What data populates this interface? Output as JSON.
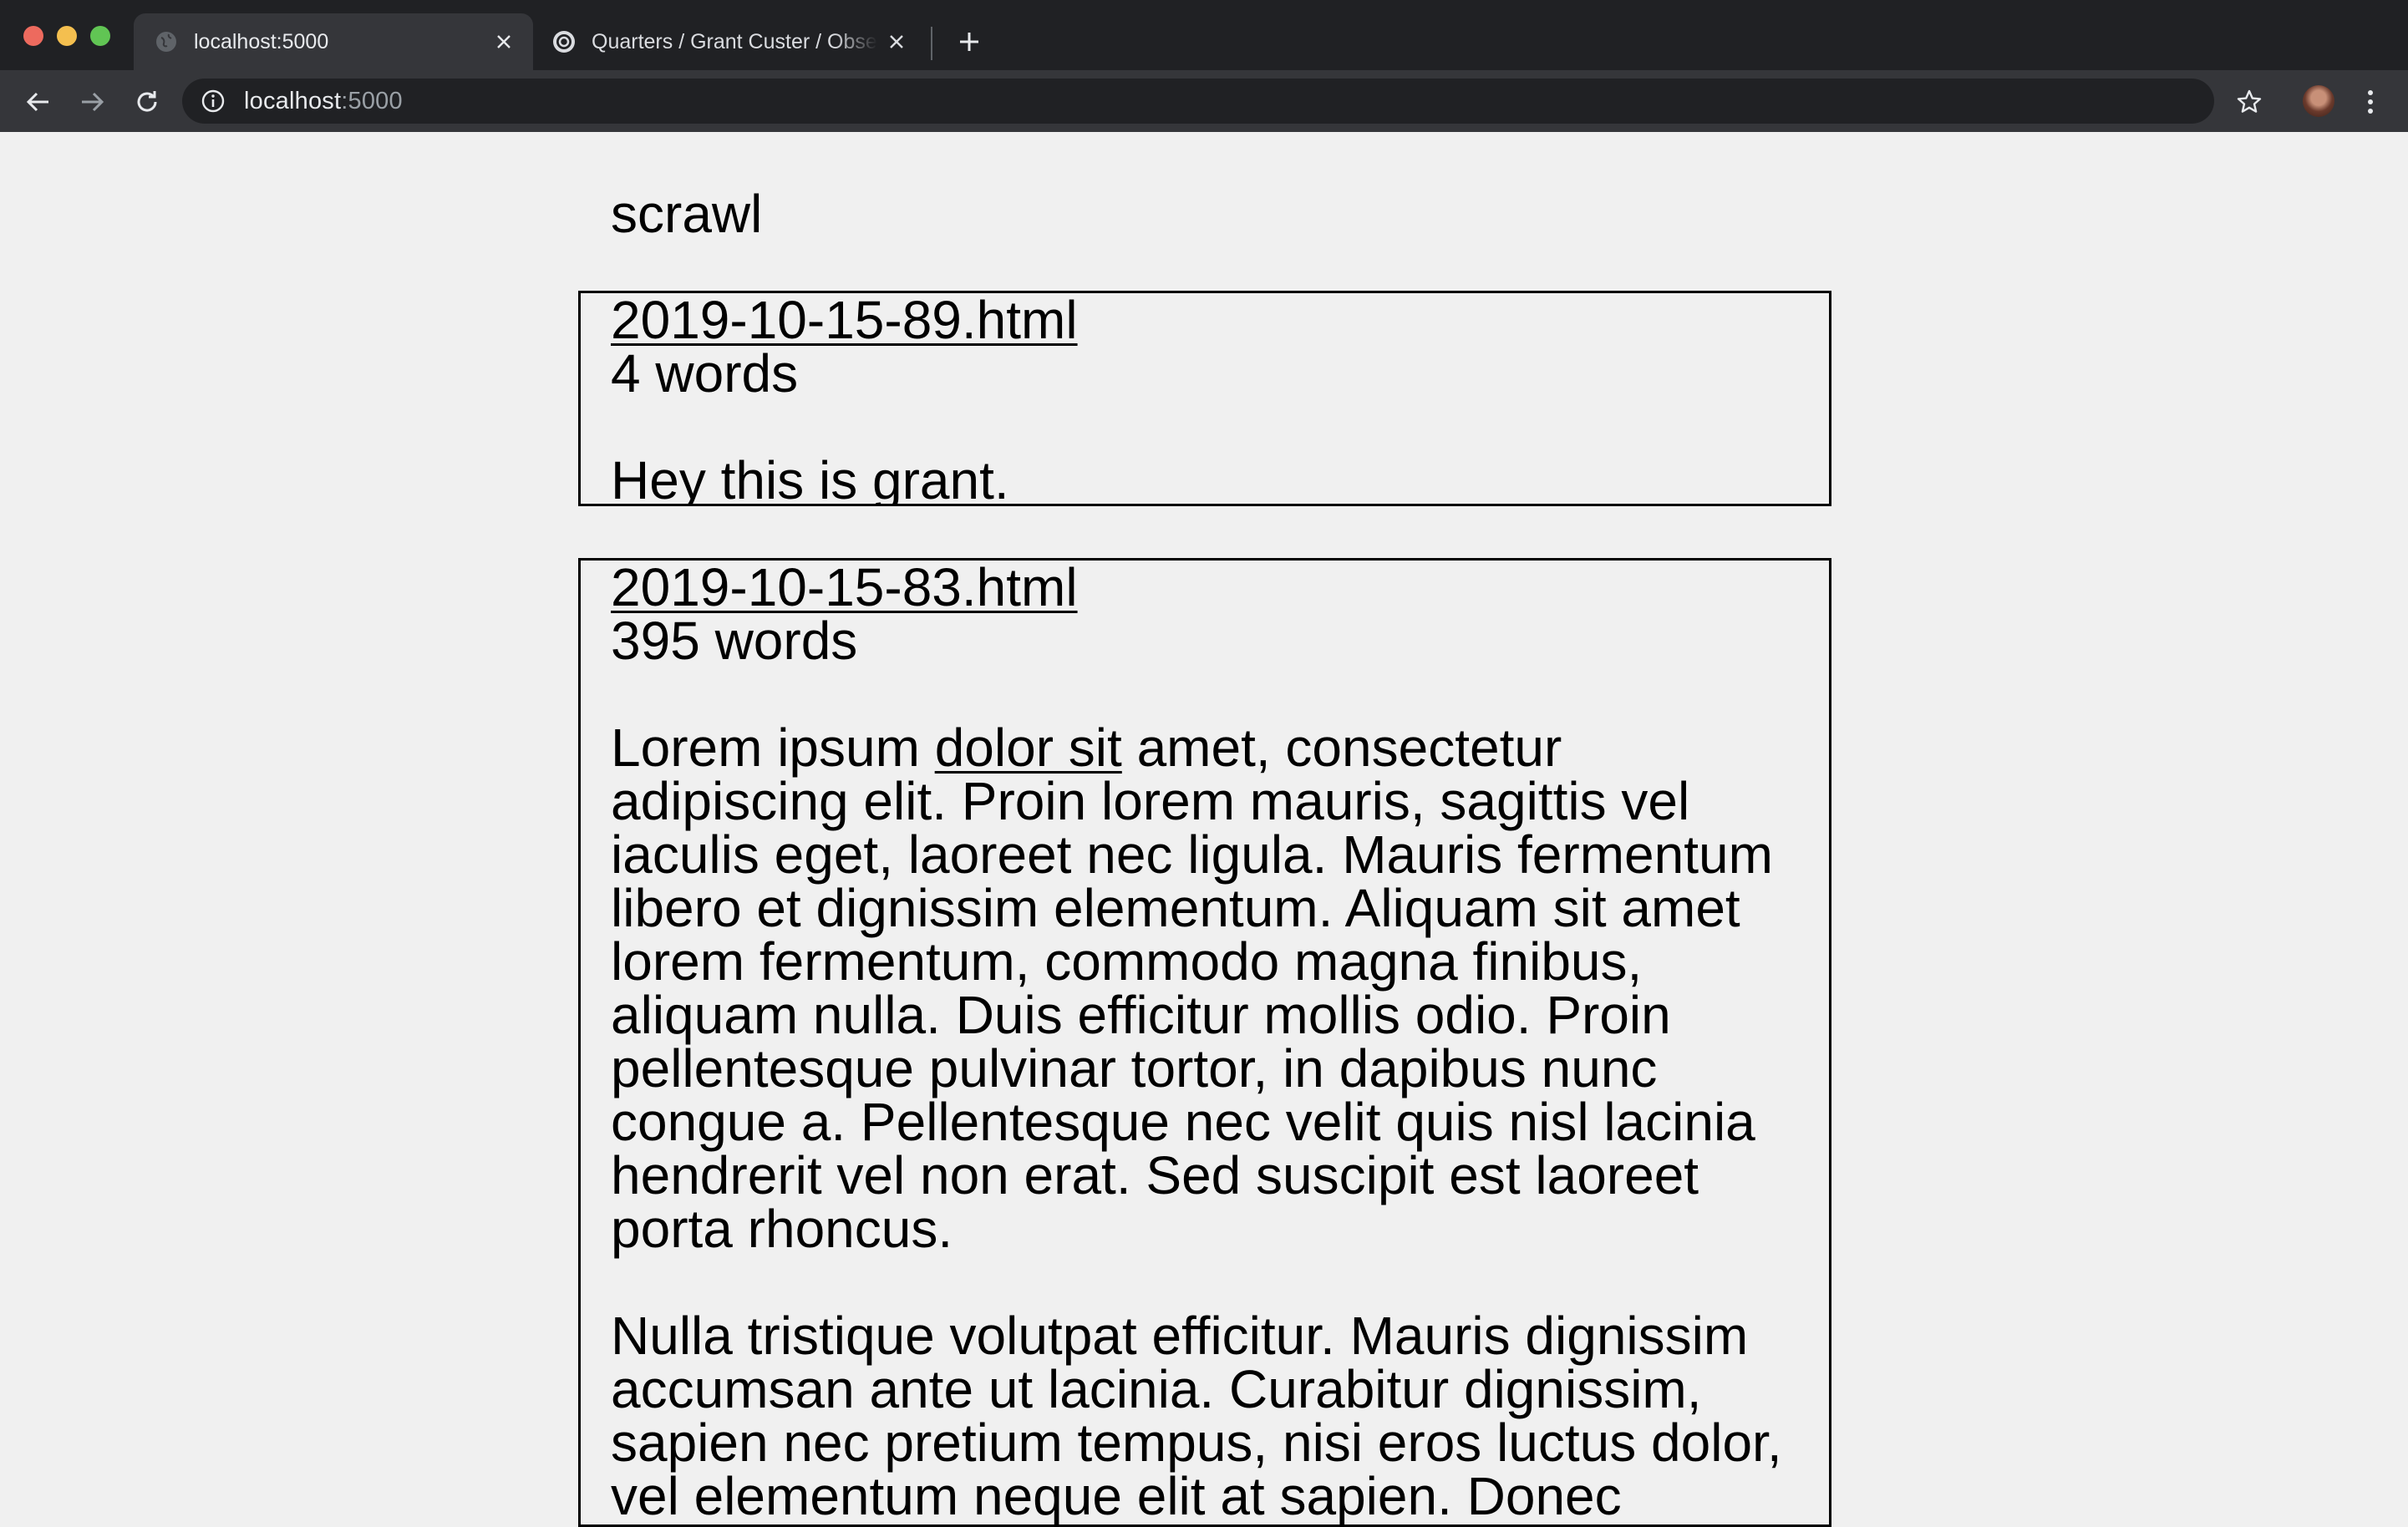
{
  "browser": {
    "tabs": [
      {
        "title": "localhost:5000",
        "active": true,
        "favicon": "globe-icon"
      },
      {
        "title": "Quarters / Grant Custer / Observable",
        "active": false,
        "favicon": "observable-icon"
      }
    ],
    "address": {
      "host": "localhost",
      "port": ":5000"
    }
  },
  "page": {
    "site_title": "scrawl",
    "entries": [
      {
        "filename": "2019-10-15-89.html",
        "word_count": "4 words",
        "paragraphs": [
          "Hey this is grant."
        ]
      },
      {
        "filename": "2019-10-15-83.html",
        "word_count": "395 words",
        "p1": {
          "before_link": "Lorem ipsum ",
          "link": "dolor sit",
          "after_link": " amet, consectetur adipiscing elit. Proin lorem mauris, sagittis vel iaculis eget, laoreet nec ligula. Mauris fermentum libero et dignissim elementum. Aliquam sit amet lorem fermentum, commodo magna finibus, aliquam nulla. Duis efficitur mollis odio. Proin pellentesque pulvinar tortor, in dapibus nunc congue a. Pellentesque nec velit quis nisl lacinia hendrerit vel non erat. Sed suscipit est laoreet porta rhoncus."
        },
        "p2": "Nulla tristique volutpat efficitur. Mauris dignissim accumsan ante ut lacinia. Curabitur dignissim, sapien nec pretium tempus, nisi eros luctus dolor, vel elementum neque elit at sapien. Donec"
      }
    ]
  },
  "colors": {
    "chrome_dark": "#202124",
    "chrome_toolbar": "#35363a",
    "page_background": "#f0f0f0",
    "text": "#000000"
  }
}
